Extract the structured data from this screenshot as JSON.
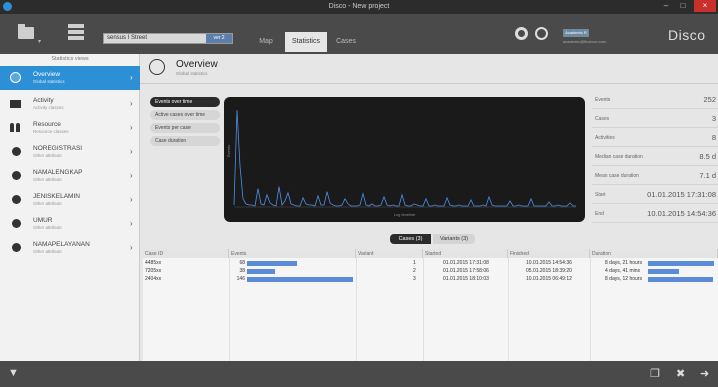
{
  "window": {
    "title": "Disco - New project"
  },
  "toolbar": {
    "project_name": "sensus I Street",
    "project_button": "ver 2",
    "tabs": [
      "Map",
      "Statistics",
      "Cases"
    ],
    "active_tab": "Statistics",
    "license_badge": "Academic R",
    "license_email": "academic@fluxicon.com",
    "logo": "Disco"
  },
  "sidebar": {
    "header": "Statistics views",
    "items": [
      {
        "label": "Overview",
        "sub": "Global statistics",
        "icon": "globe-icon",
        "active": true
      },
      {
        "label": "Activity",
        "sub": "Activity classes",
        "icon": "activity-icon"
      },
      {
        "label": "Resource",
        "sub": "Resource classes",
        "icon": "resource-icon"
      },
      {
        "label": "NOREGISTRASI",
        "sub": "Other attribute",
        "icon": "attribute-icon"
      },
      {
        "label": "NAMALENGKAP",
        "sub": "Other attribute",
        "icon": "attribute-icon"
      },
      {
        "label": "JENISKELAMIN",
        "sub": "Other attribute",
        "icon": "attribute-icon"
      },
      {
        "label": "UMUR",
        "sub": "Other attribute",
        "icon": "attribute-icon"
      },
      {
        "label": "NAMAPELAYANAN",
        "sub": "Other attribute",
        "icon": "attribute-icon"
      }
    ]
  },
  "main": {
    "title": "Overview",
    "subtitle": "Global statistics",
    "chart_menu": [
      "Events over time",
      "Active cases over time",
      "Events per case",
      "Case duration"
    ],
    "active_chart": "Events over time"
  },
  "chart_data": {
    "type": "line",
    "title": "",
    "xlabel": "Log timeline",
    "ylabel": "Events",
    "ylim": [
      0,
      100
    ],
    "values": [
      2,
      95,
      40,
      8,
      3,
      2,
      2,
      1,
      18,
      3,
      2,
      12,
      4,
      2,
      1,
      20,
      2,
      6,
      14,
      3,
      2,
      1,
      1,
      9,
      3,
      2,
      2,
      1,
      11,
      2,
      2,
      15,
      4,
      2,
      1,
      1,
      2,
      8,
      3,
      1,
      1,
      1,
      2,
      13,
      2,
      1,
      3,
      1,
      1,
      2,
      10,
      2,
      1,
      2,
      1,
      1,
      12,
      2,
      1,
      1,
      3,
      2,
      1,
      1,
      8,
      1,
      1,
      2,
      1,
      1,
      1,
      9,
      2,
      1,
      1,
      2,
      1,
      1,
      1,
      7,
      1,
      1,
      1,
      2,
      1,
      10,
      2,
      1,
      1,
      1,
      1,
      1,
      6,
      1,
      1,
      2,
      1,
      1,
      1,
      8,
      1,
      1,
      1,
      1,
      1,
      5,
      1,
      1,
      2,
      1,
      1,
      1,
      4,
      1,
      1
    ]
  },
  "stats": [
    {
      "key": "Events",
      "value": "252"
    },
    {
      "key": "Cases",
      "value": "3"
    },
    {
      "key": "Activities",
      "value": "8"
    },
    {
      "key": "Median case duration",
      "value": "8.5 d"
    },
    {
      "key": "Mean case duration",
      "value": "7.1 d"
    },
    {
      "key": "Start",
      "value": "01.01.2015 17:31:08"
    },
    {
      "key": "End",
      "value": "10.01.2015 14:54:36"
    }
  ],
  "toggle": {
    "cases": "Cases (3)",
    "variants": "Variants (3)"
  },
  "table": {
    "headers": [
      "Case ID",
      "Events",
      "Variant",
      "Started",
      "Finished",
      "Duration"
    ],
    "rows": [
      {
        "id": "4485xx",
        "events": "68",
        "events_frac": 0.47,
        "variant": "1",
        "started": "01.01.2015 17:31:08",
        "finished": "10.01.2015 14:54:36",
        "duration": "8 days, 21 hours",
        "duration_frac": 0.97
      },
      {
        "id": "7205xx",
        "events": "38",
        "events_frac": 0.26,
        "variant": "2",
        "started": "01.01.2015 17:58:06",
        "finished": "05.01.2015 18:39:20",
        "duration": "4 days, 41 mins",
        "duration_frac": 0.46
      },
      {
        "id": "2404xx",
        "events": "146",
        "events_frac": 1.0,
        "variant": "3",
        "started": "01.01.2015 18:10:03",
        "finished": "10.01.2015 06:49:12",
        "duration": "8 days, 12 hours",
        "duration_frac": 0.95
      }
    ]
  },
  "colors": {
    "accent": "#2d8fd5",
    "bar": "#5b8bd6",
    "chart_line": "#4f8fe8",
    "toolbar": "#4a4a4a"
  }
}
